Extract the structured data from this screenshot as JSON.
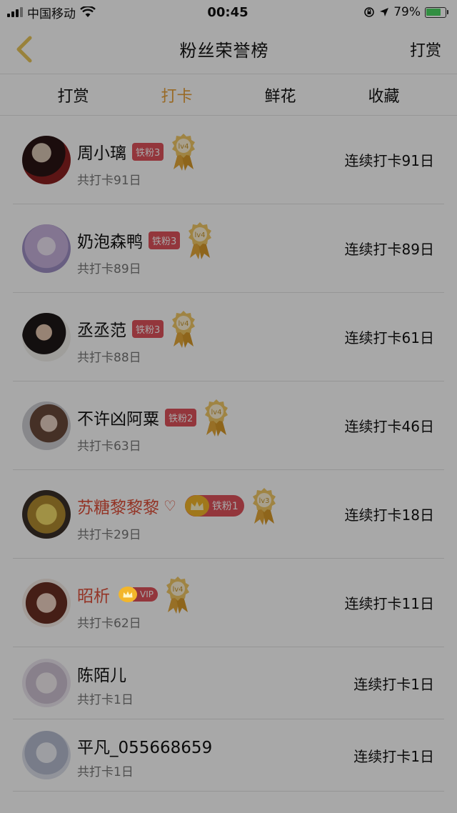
{
  "status": {
    "carrier": "中国移动",
    "time": "00:45",
    "battery": "79%",
    "battery_level": 0.79
  },
  "header": {
    "title": "粉丝荣誉榜",
    "action": "打赏"
  },
  "tabs": [
    {
      "label": "打赏",
      "active": false
    },
    {
      "label": "打卡",
      "active": true
    },
    {
      "label": "鲜花",
      "active": false
    },
    {
      "label": "收藏",
      "active": false
    }
  ],
  "fans": [
    {
      "name": "周小璃",
      "badge": "铁粉3",
      "level": "lv4",
      "total": "共打卡91日",
      "streak": "连续打卡91日",
      "avatar_color": "#5a2a2a"
    },
    {
      "name": "奶泡森鸭",
      "badge": "铁粉3",
      "level": "lv4",
      "total": "共打卡89日",
      "streak": "连续打卡89日",
      "avatar_color": "#c9b8e0"
    },
    {
      "name": "丞丞范",
      "badge": "铁粉3",
      "level": "lv4",
      "total": "共打卡88日",
      "streak": "连续打卡61日",
      "avatar_color": "#3a3030"
    },
    {
      "name": "不许凶阿粟",
      "badge": "铁粉2",
      "level": "lv4",
      "total": "共打卡63日",
      "streak": "连续打卡46日",
      "avatar_color": "#a89890"
    },
    {
      "name": "苏糖黎黎黎",
      "badge": "铁粉1",
      "level": "lv3",
      "total": "共打卡29日",
      "streak": "连续打卡18日",
      "avatar_color": "#b89a40"
    },
    {
      "name": "昭析",
      "badge": "VIP",
      "level": "lv4",
      "total": "共打卡62日",
      "streak": "连续打卡11日",
      "avatar_color": "#b06a50"
    },
    {
      "name": "陈陌儿",
      "total": "共打卡1日",
      "streak": "连续打卡1日",
      "avatar_color": "#d8d4dc"
    },
    {
      "name": "平凡_055668659",
      "total": "共打卡1日",
      "streak": "连续打卡1日",
      "avatar_color": "#c8ccd8"
    }
  ]
}
